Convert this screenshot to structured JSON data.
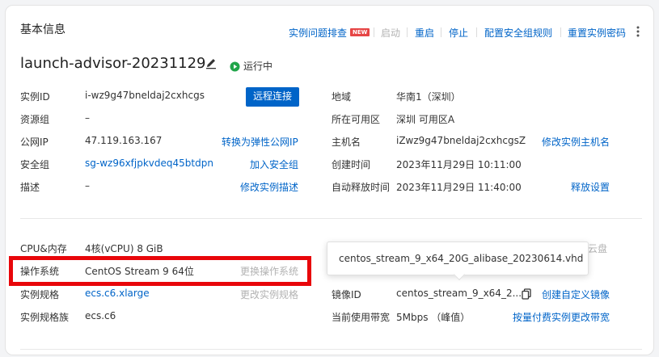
{
  "header": {
    "title": "基本信息",
    "new_badge": "NEW",
    "actions": {
      "troubleshoot": "实例问题排查",
      "start": "启动",
      "restart": "重启",
      "stop": "停止",
      "sg_rules": "配置安全组规则",
      "reset_password": "重置实例密码"
    }
  },
  "instance": {
    "name": "launch-advisor-20231129",
    "status": "运行中",
    "status_color": "#21a54a"
  },
  "left": {
    "instance_id": {
      "label": "实例ID",
      "value": "i-wz9g47bneldaj2cxhcgs",
      "button": "远程连接"
    },
    "resource_group": {
      "label": "资源组",
      "value": "–"
    },
    "public_ip": {
      "label": "公网IP",
      "value": "47.119.163.167",
      "action": "转换为弹性公网IP"
    },
    "security_group": {
      "label": "安全组",
      "value": "sg-wz96xfjpkvdeq45btdpn",
      "action": "加入安全组"
    },
    "description": {
      "label": "描述",
      "value": "–",
      "action": "修改实例描述"
    }
  },
  "right": {
    "region": {
      "label": "地域",
      "value": "华南1（深圳）"
    },
    "zone": {
      "label": "所在可用区",
      "value": "深圳 可用区A"
    },
    "hostname": {
      "label": "主机名",
      "value": "iZwz9g47bneldaj2cxhcgsZ",
      "action": "修改实例主机名"
    },
    "created": {
      "label": "创建时间",
      "value": "2023年11月29日 10:11:00"
    },
    "auto_release": {
      "label": "自动释放时间",
      "value": "2023年11月29日 11:40:00",
      "action": "释放设置"
    }
  },
  "config_left": {
    "cpu_mem": {
      "label": "CPU&内存",
      "value": "4核(vCPU) 8 GiB"
    },
    "os": {
      "label": "操作系统",
      "value": "CentOS Stream 9 64位",
      "action": "更换操作系统"
    },
    "spec": {
      "label": "实例规格",
      "value": "ecs.c6.xlarge",
      "action": "更改实例规格"
    },
    "family": {
      "label": "实例规格族",
      "value": "ecs.c6"
    }
  },
  "config_right": {
    "partial_text": "云盘",
    "image": {
      "label": "镜像ID",
      "value": "centos_stream_9_x64_2...",
      "action": "创建自定义镜像"
    },
    "bandwidth": {
      "label": "当前使用带宽",
      "value": "5Mbps （峰值）",
      "action": "按量付费实例更改带宽"
    }
  },
  "tooltip": {
    "text": "centos_stream_9_x64_20G_alibase_20230614.vhd"
  }
}
